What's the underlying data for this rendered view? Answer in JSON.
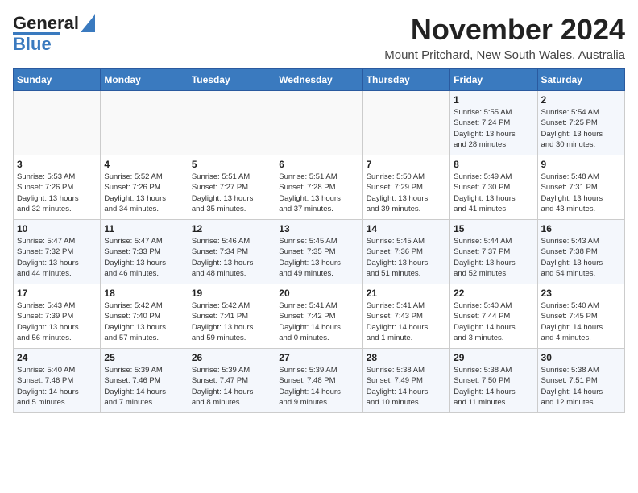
{
  "header": {
    "logo_line1": "General",
    "logo_line2": "Blue",
    "month_year": "November 2024",
    "location": "Mount Pritchard, New South Wales, Australia"
  },
  "days_of_week": [
    "Sunday",
    "Monday",
    "Tuesday",
    "Wednesday",
    "Thursday",
    "Friday",
    "Saturday"
  ],
  "weeks": [
    [
      {
        "day": "",
        "info": ""
      },
      {
        "day": "",
        "info": ""
      },
      {
        "day": "",
        "info": ""
      },
      {
        "day": "",
        "info": ""
      },
      {
        "day": "",
        "info": ""
      },
      {
        "day": "1",
        "info": "Sunrise: 5:55 AM\nSunset: 7:24 PM\nDaylight: 13 hours\nand 28 minutes."
      },
      {
        "day": "2",
        "info": "Sunrise: 5:54 AM\nSunset: 7:25 PM\nDaylight: 13 hours\nand 30 minutes."
      }
    ],
    [
      {
        "day": "3",
        "info": "Sunrise: 5:53 AM\nSunset: 7:26 PM\nDaylight: 13 hours\nand 32 minutes."
      },
      {
        "day": "4",
        "info": "Sunrise: 5:52 AM\nSunset: 7:26 PM\nDaylight: 13 hours\nand 34 minutes."
      },
      {
        "day": "5",
        "info": "Sunrise: 5:51 AM\nSunset: 7:27 PM\nDaylight: 13 hours\nand 35 minutes."
      },
      {
        "day": "6",
        "info": "Sunrise: 5:51 AM\nSunset: 7:28 PM\nDaylight: 13 hours\nand 37 minutes."
      },
      {
        "day": "7",
        "info": "Sunrise: 5:50 AM\nSunset: 7:29 PM\nDaylight: 13 hours\nand 39 minutes."
      },
      {
        "day": "8",
        "info": "Sunrise: 5:49 AM\nSunset: 7:30 PM\nDaylight: 13 hours\nand 41 minutes."
      },
      {
        "day": "9",
        "info": "Sunrise: 5:48 AM\nSunset: 7:31 PM\nDaylight: 13 hours\nand 43 minutes."
      }
    ],
    [
      {
        "day": "10",
        "info": "Sunrise: 5:47 AM\nSunset: 7:32 PM\nDaylight: 13 hours\nand 44 minutes."
      },
      {
        "day": "11",
        "info": "Sunrise: 5:47 AM\nSunset: 7:33 PM\nDaylight: 13 hours\nand 46 minutes."
      },
      {
        "day": "12",
        "info": "Sunrise: 5:46 AM\nSunset: 7:34 PM\nDaylight: 13 hours\nand 48 minutes."
      },
      {
        "day": "13",
        "info": "Sunrise: 5:45 AM\nSunset: 7:35 PM\nDaylight: 13 hours\nand 49 minutes."
      },
      {
        "day": "14",
        "info": "Sunrise: 5:45 AM\nSunset: 7:36 PM\nDaylight: 13 hours\nand 51 minutes."
      },
      {
        "day": "15",
        "info": "Sunrise: 5:44 AM\nSunset: 7:37 PM\nDaylight: 13 hours\nand 52 minutes."
      },
      {
        "day": "16",
        "info": "Sunrise: 5:43 AM\nSunset: 7:38 PM\nDaylight: 13 hours\nand 54 minutes."
      }
    ],
    [
      {
        "day": "17",
        "info": "Sunrise: 5:43 AM\nSunset: 7:39 PM\nDaylight: 13 hours\nand 56 minutes."
      },
      {
        "day": "18",
        "info": "Sunrise: 5:42 AM\nSunset: 7:40 PM\nDaylight: 13 hours\nand 57 minutes."
      },
      {
        "day": "19",
        "info": "Sunrise: 5:42 AM\nSunset: 7:41 PM\nDaylight: 13 hours\nand 59 minutes."
      },
      {
        "day": "20",
        "info": "Sunrise: 5:41 AM\nSunset: 7:42 PM\nDaylight: 14 hours\nand 0 minutes."
      },
      {
        "day": "21",
        "info": "Sunrise: 5:41 AM\nSunset: 7:43 PM\nDaylight: 14 hours\nand 1 minute."
      },
      {
        "day": "22",
        "info": "Sunrise: 5:40 AM\nSunset: 7:44 PM\nDaylight: 14 hours\nand 3 minutes."
      },
      {
        "day": "23",
        "info": "Sunrise: 5:40 AM\nSunset: 7:45 PM\nDaylight: 14 hours\nand 4 minutes."
      }
    ],
    [
      {
        "day": "24",
        "info": "Sunrise: 5:40 AM\nSunset: 7:46 PM\nDaylight: 14 hours\nand 5 minutes."
      },
      {
        "day": "25",
        "info": "Sunrise: 5:39 AM\nSunset: 7:46 PM\nDaylight: 14 hours\nand 7 minutes."
      },
      {
        "day": "26",
        "info": "Sunrise: 5:39 AM\nSunset: 7:47 PM\nDaylight: 14 hours\nand 8 minutes."
      },
      {
        "day": "27",
        "info": "Sunrise: 5:39 AM\nSunset: 7:48 PM\nDaylight: 14 hours\nand 9 minutes."
      },
      {
        "day": "28",
        "info": "Sunrise: 5:38 AM\nSunset: 7:49 PM\nDaylight: 14 hours\nand 10 minutes."
      },
      {
        "day": "29",
        "info": "Sunrise: 5:38 AM\nSunset: 7:50 PM\nDaylight: 14 hours\nand 11 minutes."
      },
      {
        "day": "30",
        "info": "Sunrise: 5:38 AM\nSunset: 7:51 PM\nDaylight: 14 hours\nand 12 minutes."
      }
    ]
  ]
}
